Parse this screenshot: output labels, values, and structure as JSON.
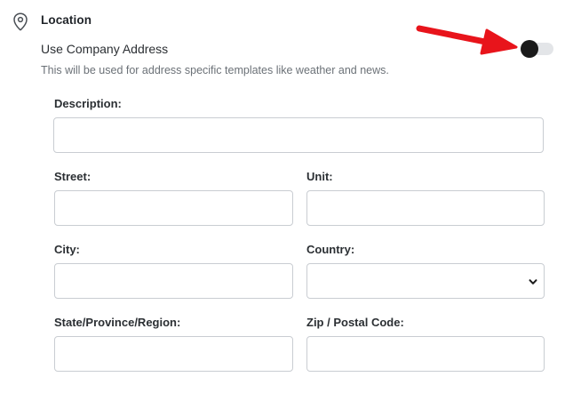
{
  "location": {
    "title": "Location",
    "use_company_address": {
      "label": "Use Company Address",
      "help": "This will be used for address specific templates like weather and news.",
      "enabled": false
    }
  },
  "form": {
    "description": {
      "label": "Description:",
      "value": ""
    },
    "street": {
      "label": "Street:",
      "value": ""
    },
    "unit": {
      "label": "Unit:",
      "value": ""
    },
    "city": {
      "label": "City:",
      "value": ""
    },
    "country": {
      "label": "Country:",
      "selected": ""
    },
    "state": {
      "label": "State/Province/Region:",
      "value": ""
    },
    "zip": {
      "label": "Zip / Postal Code:",
      "value": ""
    }
  },
  "colors": {
    "annotation_arrow": "#e8141b",
    "toggle_knob": "#1a1a1a",
    "toggle_track": "#e3e5e8",
    "input_border": "#c9cdd2"
  },
  "icons": {
    "section": "map-pin-icon",
    "select": "chevron-down-icon",
    "annotation": "red-arrow-icon"
  }
}
